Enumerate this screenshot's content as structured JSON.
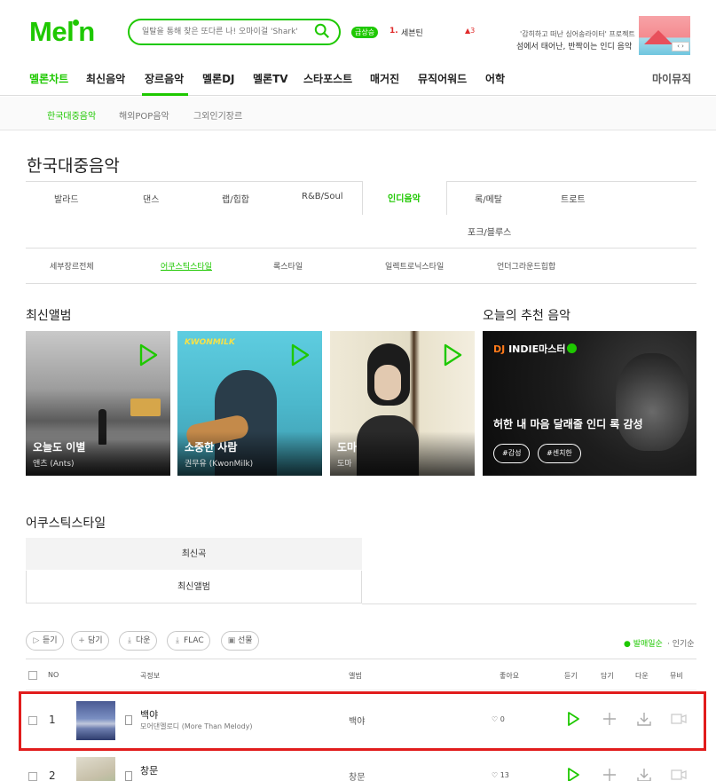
{
  "header": {
    "logo": "Melon",
    "logo_parts": [
      "Mel",
      "n"
    ],
    "search_placeholder": "일탈을 통해 찾은 또다른 나! 오마이걸 'Shark'",
    "rising_badge": "급상승",
    "rising_rank": "1.",
    "rising_title": "세븐틴",
    "rising_change": "3",
    "promo_line1": "'감히하고 떠난 싱어송라이터' 프로젝트",
    "promo_line2": "섬에서 태어난, 반짝이는 인디 음악"
  },
  "gnb": {
    "items": [
      "멜론차트",
      "최신음악",
      "장르음악",
      "멜론DJ",
      "멜론TV",
      "스타포스트",
      "매거진",
      "뮤직어워드",
      "어학"
    ],
    "my": "마이뮤직"
  },
  "subgnb": [
    "한국대중음악",
    "해외POP음악",
    "그외인기장르"
  ],
  "page_title": "한국대중음악",
  "genres": [
    "발라드",
    "댄스",
    "랩/힙합",
    "R&B/Soul",
    "인디음악",
    "록/메탈",
    "트로트",
    "포크/블루스"
  ],
  "sub_genres": [
    "세부장르전체",
    "어쿠스틱스타일",
    "록스타일",
    "일렉트로닉스타일",
    "언더그라운드힙합"
  ],
  "latest_albums": {
    "title": "최신앨범",
    "items": [
      {
        "title": "오늘도 이별",
        "artist": "앤츠 (Ants)"
      },
      {
        "title": "소중한 사람",
        "artist": "권무유 (KwonMilk)"
      },
      {
        "title": "도마",
        "artist": "도마"
      }
    ],
    "kwonmilk_logo": "KWONMILK"
  },
  "recommend": {
    "title": "오늘의 추천 음악",
    "dj_prefix": "DJ",
    "dj_name": "INDIE마스터",
    "playlist": "허한 내 마음 달래줄 인디 록 감성",
    "tags": [
      "#감성",
      "#센치한"
    ]
  },
  "section2_title": "어쿠스틱스타일",
  "tabs": [
    "최신곡",
    "최신앨범"
  ],
  "actions": {
    "buttons": [
      "듣기",
      "담기",
      "다운",
      "FLAC",
      "선물"
    ],
    "sort": [
      "발매일순",
      "인기순"
    ]
  },
  "table": {
    "headers": [
      "NO",
      "곡정보",
      "앨범",
      "좋아요",
      "듣기",
      "담기",
      "다운",
      "뮤비"
    ],
    "rows": [
      {
        "no": "1",
        "title": "백야",
        "artist": "모어댄멜로디 (More Than Melody)",
        "album": "백야",
        "likes": "0"
      },
      {
        "no": "2",
        "title": "창문",
        "artist": "",
        "album": "창문",
        "likes": "13"
      }
    ]
  },
  "colors": {
    "brand": "#1ec800",
    "highlight": "#e11c1c"
  }
}
